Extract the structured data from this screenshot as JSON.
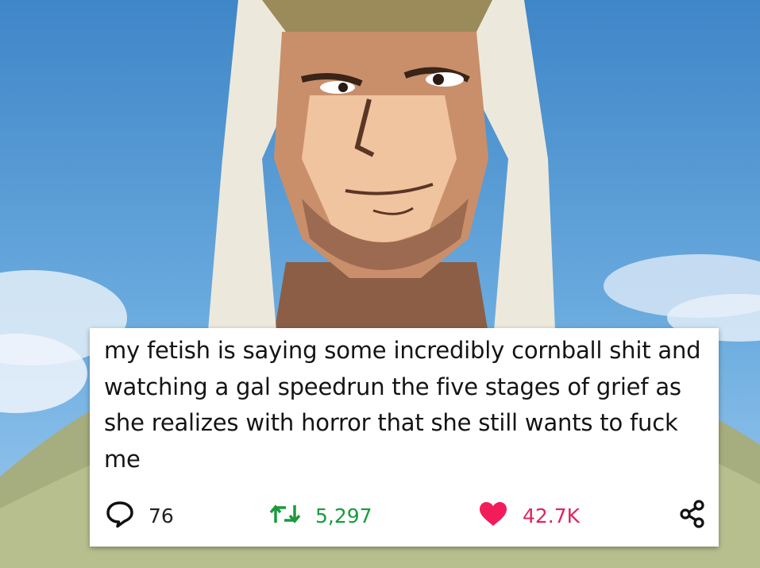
{
  "post": {
    "text": "my fetish is saying some incredibly cornball shit and watching a gal speedrun the five stages of grief as she realizes with horror that she still wants to fuck me",
    "reply_count": "76",
    "retweet_count": "5,297",
    "like_count": "42.7K"
  },
  "icons": {
    "reply": "speech-bubble-icon",
    "retweet": "retweet-arrows-icon",
    "like": "heart-icon",
    "share": "share-nodes-icon"
  },
  "colors": {
    "retweet": "#1a9b3c",
    "like": "#e0245e",
    "sky": "#5fa0d6",
    "card": "#ffffff"
  }
}
